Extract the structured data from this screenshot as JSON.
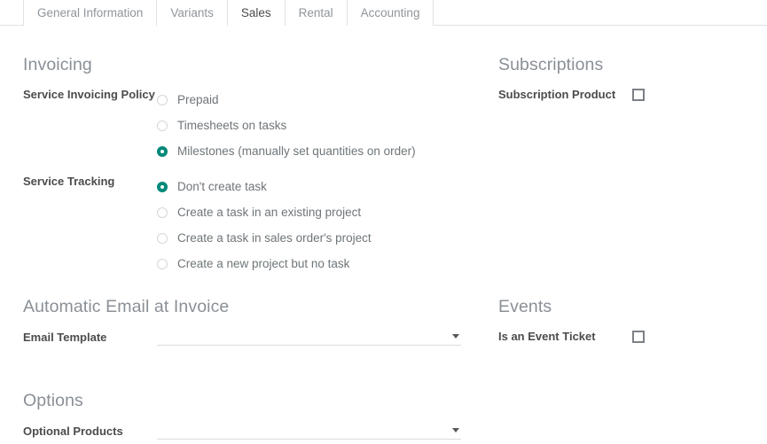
{
  "tabs": [
    {
      "label": "General Information",
      "active": false
    },
    {
      "label": "Variants",
      "active": false
    },
    {
      "label": "Sales",
      "active": true
    },
    {
      "label": "Rental",
      "active": false
    },
    {
      "label": "Accounting",
      "active": false
    }
  ],
  "colors": {
    "accent_teal": "#00897a",
    "heading_gray": "#8a9097",
    "label_gray": "#4c4c4c",
    "radio_label_gray": "#6f7579",
    "border_gray": "#dee2e6"
  },
  "left_column": {
    "invoicing": {
      "title": "Invoicing",
      "service_invoicing_policy": {
        "label": "Service Invoicing Policy",
        "options": [
          {
            "label": "Prepaid",
            "selected": false
          },
          {
            "label": "Timesheets on tasks",
            "selected": false
          },
          {
            "label": "Milestones (manually set quantities on order)",
            "selected": true
          }
        ]
      },
      "service_tracking": {
        "label": "Service Tracking",
        "options": [
          {
            "label": "Don't create task",
            "selected": true
          },
          {
            "label": "Create a task in an existing project",
            "selected": false
          },
          {
            "label": "Create a task in sales order's project",
            "selected": false
          },
          {
            "label": "Create a new project but no task",
            "selected": false
          }
        ]
      }
    },
    "automatic_email": {
      "title": "Automatic Email at Invoice",
      "email_template": {
        "label": "Email Template",
        "value": "",
        "placeholder": ""
      }
    },
    "options": {
      "title": "Options",
      "optional_products": {
        "label": "Optional Products",
        "value": "",
        "placeholder": ""
      }
    }
  },
  "right_column": {
    "subscriptions": {
      "title": "Subscriptions",
      "subscription_product": {
        "label": "Subscription Product",
        "checked": false
      }
    },
    "events": {
      "title": "Events",
      "is_an_event_ticket": {
        "label": "Is an Event Ticket",
        "checked": false
      }
    }
  }
}
